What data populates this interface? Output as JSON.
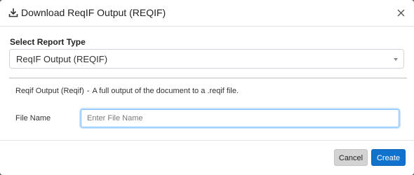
{
  "dialog": {
    "title": "Download ReqIF Output (REQIF)",
    "icons": {
      "download": "download-icon",
      "close": "close-icon",
      "dropdown": "chevron-down-icon"
    }
  },
  "report_type": {
    "label": "Select Report Type",
    "selected": "ReqIF Output (REQIF)"
  },
  "description": {
    "name": "Reqif Output (Reqif)",
    "separator": "-",
    "text": "A full output of the document to a .reqif file."
  },
  "file_name": {
    "label": "File Name",
    "value": "",
    "placeholder": "Enter File Name"
  },
  "buttons": {
    "cancel": "Cancel",
    "create": "Create"
  },
  "colors": {
    "primary": "#1072cc",
    "secondary": "#d3d3d3",
    "focus": "#80bdff"
  }
}
